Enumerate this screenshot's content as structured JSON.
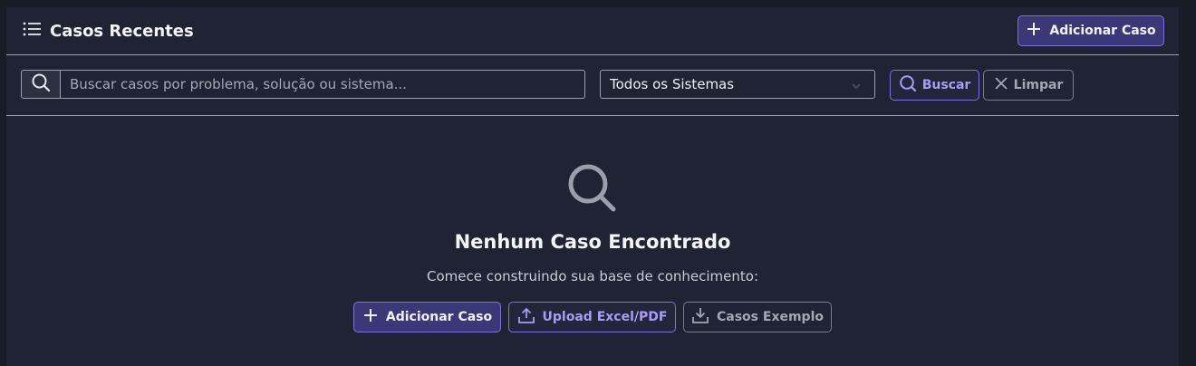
{
  "header": {
    "title": "Casos Recentes",
    "add_button_label": "Adicionar Caso"
  },
  "filters": {
    "search_placeholder": "Buscar casos por problema, solução ou sistema...",
    "search_value": "",
    "system_select_value": "Todos os Sistemas",
    "search_button_label": "Buscar",
    "clear_button_label": "Limpar"
  },
  "empty_state": {
    "title": "Nenhum Caso Encontrado",
    "subtitle": "Comece construindo sua base de conhecimento:",
    "add_button_label": "Adicionar Caso",
    "upload_button_label": "Upload Excel/PDF",
    "examples_button_label": "Casos Exemplo"
  },
  "colors": {
    "background": "#181c27",
    "panel": "#1f2333",
    "accent_purple": "#7b72e0",
    "primary_button_bg": "#3b3878",
    "muted_text": "#a3a8b3"
  },
  "icons": [
    "list-icon",
    "plus-icon",
    "search-icon",
    "chevron-down-icon",
    "close-icon",
    "upload-icon",
    "download-icon"
  ]
}
